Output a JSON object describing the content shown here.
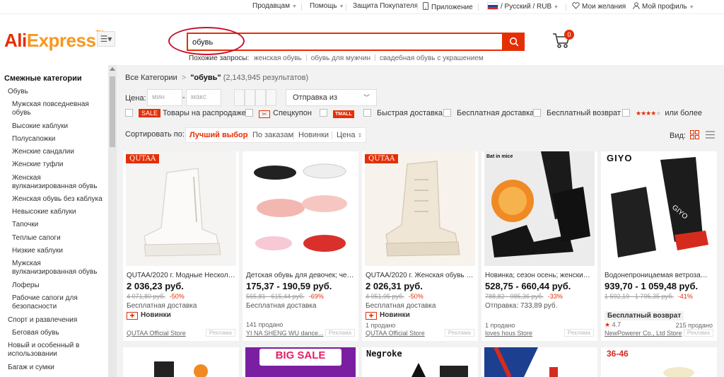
{
  "topbar": {
    "sellers": "Продавцам",
    "help": "Помощь",
    "buyer_protection": "Защита Покупателя",
    "app": "Приложение",
    "locale": "/ Русский /  RUB",
    "wishlist": "Мои желания",
    "profile": "Мой профиль"
  },
  "header": {
    "logo_ali": "Ali",
    "logo_express": "Express",
    "logo_tm": "TM",
    "search_value": "обувь",
    "cart_count": "0",
    "related_label": "Похожие запросы:",
    "related": [
      "женская обувь",
      "обувь для мужчин",
      "свадебная обувь с украшением"
    ]
  },
  "sidebar": {
    "title": "Смежные категории",
    "items": [
      "Обувь",
      "Мужская повседневная обувь",
      "Высокие каблуки",
      "Полусапожки",
      "Женские сандалии",
      "Женские туфли",
      "Женская вулканизированная обувь",
      "Женская обувь без каблука",
      "Невысокие каблуки",
      "Тапочки",
      "Теплые сапоги",
      "Низкие каблуки",
      "Мужская вулканизированная обувь",
      "Лоферы",
      "Рабочие сапоги для безопасности",
      "Спорт и развлечения",
      "Беговая обувь",
      "Новый и особенный в использовании",
      "Багаж и сумки"
    ]
  },
  "breadcrumb": {
    "all": "Все Категории",
    "sep": ">",
    "query": "\"обувь\"",
    "count": "(2,143,945 результатов)"
  },
  "filters": {
    "price_label": "Цена:",
    "min_placeholder": "мин",
    "max_placeholder": "макс",
    "dash": "-",
    "ship_from": "Отправка из",
    "sale_tag": "SALE",
    "sale": "Товары на распродаже",
    "coupon": "Спецкупон",
    "tmall": "TMALL",
    "fast": "Быстрая доставка",
    "free": "Бесплатная доставка",
    "free_return": "Бесплатный возврат",
    "or_more": "или более",
    "rating_stars": 4
  },
  "sort": {
    "label": "Сортировать по:",
    "best": "Лучший выбор",
    "orders": "По заказам",
    "newest": "Новинки",
    "price": "Цена",
    "view_label": "Вид:"
  },
  "products": [
    {
      "brand": "QUTAA",
      "title": "QUTAA/2020 г. Модные Нескольз...",
      "price": "2 036,23 руб.",
      "old_price": "4 071,80 руб.",
      "discount": "-50%",
      "shipping": "Бесплатная доставка",
      "badge": "Новинки",
      "sold": "",
      "store": "QUTAA Official Store",
      "ad": "Реклама"
    },
    {
      "brand": "",
      "title": "Детская обувь для девочек; чеш...",
      "price": "175,37 - 190,59 руб.",
      "old_price": "565,81 - 615,44 руб.",
      "discount": "-69%",
      "shipping": "Бесплатная доставка",
      "badge": "",
      "sold": "141 продано",
      "store": "YI NA SHENG WU dance...",
      "ad": "Реклама"
    },
    {
      "brand": "QUTAA",
      "title": "QUTAA/2020 г. Женская обувь из ...",
      "price": "2 026,31 руб.",
      "old_price": "4 051,95 руб.",
      "discount": "-50%",
      "shipping": "Бесплатная доставка",
      "badge": "Новинки",
      "sold": "1 продано",
      "store": "QUTAA Official Store",
      "ad": "Реклама"
    },
    {
      "brand": "Bat in mice",
      "title": "Новинка; сезон осень; женские б...",
      "price": "528,75 - 660,44 руб.",
      "old_price": "788,82 - 985,36 руб.",
      "discount": "-33%",
      "shipping": "Отправка: 733,89 руб.",
      "badge": "",
      "sold": "1 продано",
      "store": "loves hous Store",
      "ad": "Реклама"
    },
    {
      "brand": "GIYO",
      "title": "Водонепроницаемая ветрозащи...",
      "price": "939,70 - 1 059,48 руб.",
      "old_price": "1 592,19 - 1 795,35 руб.",
      "discount": "-41%",
      "shipping": "Бесплатный возврат",
      "badge": "",
      "rating": "4.7",
      "sold": "215 продано",
      "store": "NewPowerer Co., Ltd Store",
      "ad": "Реклама"
    }
  ],
  "row2": {
    "big_sale": "BIG SALE",
    "negroke": "Negroke",
    "size": "36-46"
  },
  "colors": {
    "accent": "#e62e04",
    "orange": "#f7971e"
  }
}
